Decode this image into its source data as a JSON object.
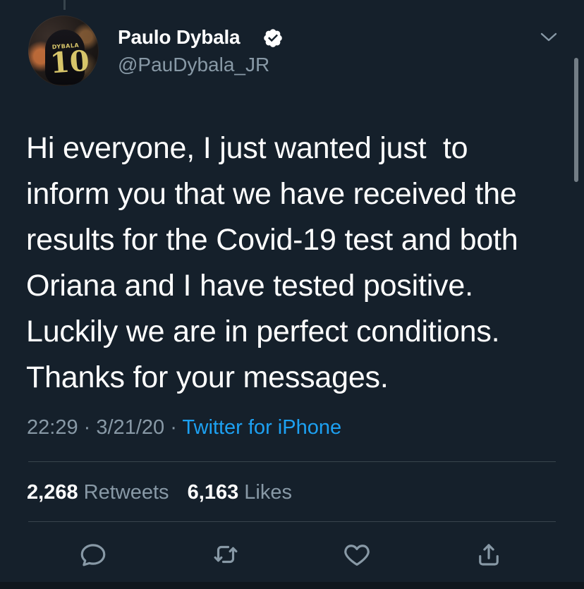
{
  "author": {
    "name": "Paulo Dybala",
    "handle": "@PauDybala_JR",
    "avatar_jersey_name": "DYBALA",
    "avatar_jersey_number": "10"
  },
  "tweet": {
    "lines": [
      "Hi everyone, I just wanted just  to",
      "inform you that we have received the",
      "results for the Covid-19 test and both",
      "Oriana and I have tested positive.",
      "Luckily we are in perfect conditions.",
      "Thanks for your messages."
    ]
  },
  "meta": {
    "time": "22:29",
    "date": "3/21/20",
    "separator": "·",
    "source": "Twitter for iPhone"
  },
  "stats": {
    "retweets_count": "2,268",
    "retweets_label": "Retweets",
    "likes_count": "6,163",
    "likes_label": "Likes"
  },
  "icons": {
    "verified": "verified-icon",
    "menu": "chevron-down-icon",
    "reply": "reply-icon",
    "retweet": "retweet-icon",
    "like": "heart-icon",
    "share": "share-icon"
  },
  "colors": {
    "background": "#15202b",
    "primary_text": "#ffffff",
    "secondary_text": "#8899a6",
    "accent": "#1da1f2",
    "divider": "#38444d"
  }
}
